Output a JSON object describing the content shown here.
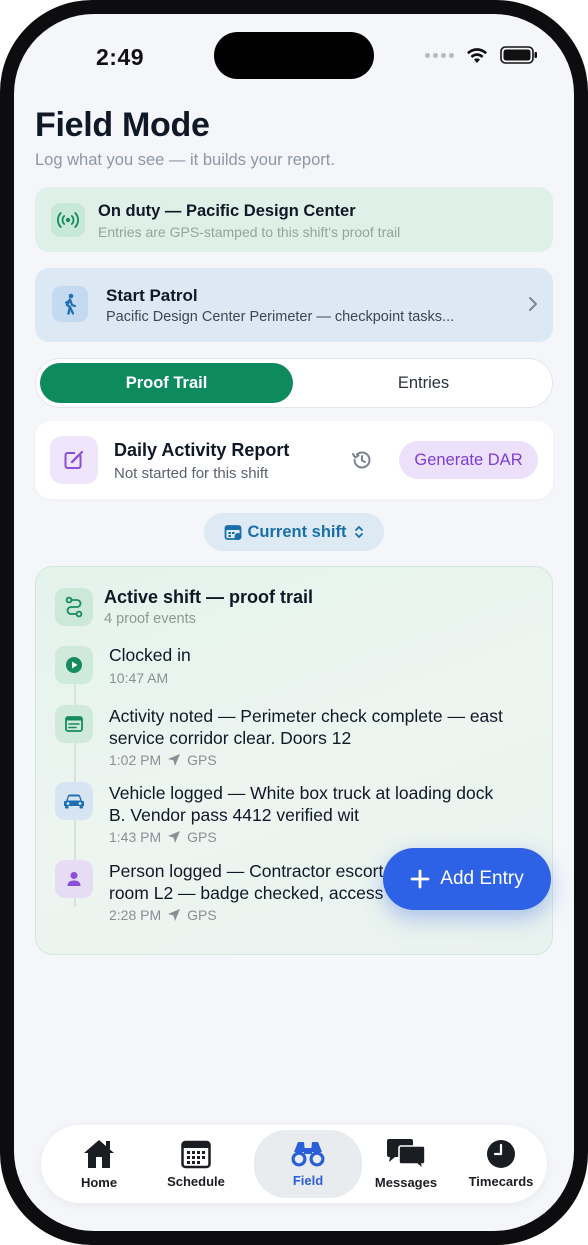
{
  "status_bar": {
    "time": "2:49"
  },
  "header": {
    "title": "Field Mode",
    "subtitle": "Log what you see — it builds your report."
  },
  "duty_banner": {
    "title": "On duty — Pacific Design Center",
    "subtitle": "Entries are GPS-stamped to this shift's proof trail",
    "icon": "broadcast-icon"
  },
  "patrol": {
    "title": "Start Patrol",
    "subtitle": "Pacific Design Center Perimeter — checkpoint tasks...",
    "icon": "walking-person-icon"
  },
  "tabs": {
    "proof_trail": "Proof Trail",
    "entries": "Entries",
    "selected": "Proof Trail"
  },
  "dar": {
    "title": "Daily Activity Report",
    "status": "Not started for this shift",
    "button": "Generate DAR"
  },
  "shift_selector": {
    "label": "Current shift"
  },
  "proof_trail": {
    "title": "Active shift — proof trail",
    "count_label": "4 proof events",
    "events": [
      {
        "title": "Clocked in",
        "time": "10:47 AM",
        "gps": "",
        "icon": "play-icon"
      },
      {
        "title": "Activity noted — Perimeter check complete — east service corridor clear. Doors 12",
        "time": "1:02 PM",
        "gps": "GPS",
        "icon": "note-icon"
      },
      {
        "title": "Vehicle logged — White box truck at loading dock B. Vendor pass 4412 verified wit",
        "time": "1:43 PM",
        "gps": "GPS",
        "icon": "car-icon"
      },
      {
        "title": "Person logged — Contractor escort to mechanical room L2 — badge checked, access",
        "time": "2:28 PM",
        "gps": "GPS",
        "icon": "person-icon"
      }
    ]
  },
  "fab": {
    "label": "Add Entry"
  },
  "tabbar": {
    "items": [
      {
        "label": "Home"
      },
      {
        "label": "Schedule"
      },
      {
        "label": "Field"
      },
      {
        "label": "Messages"
      },
      {
        "label": "Timecards"
      }
    ],
    "active": "Field"
  },
  "colors": {
    "primary_green": "#0e8a5f",
    "accent_blue": "#2e62e6",
    "purple": "#7e3ed2"
  }
}
